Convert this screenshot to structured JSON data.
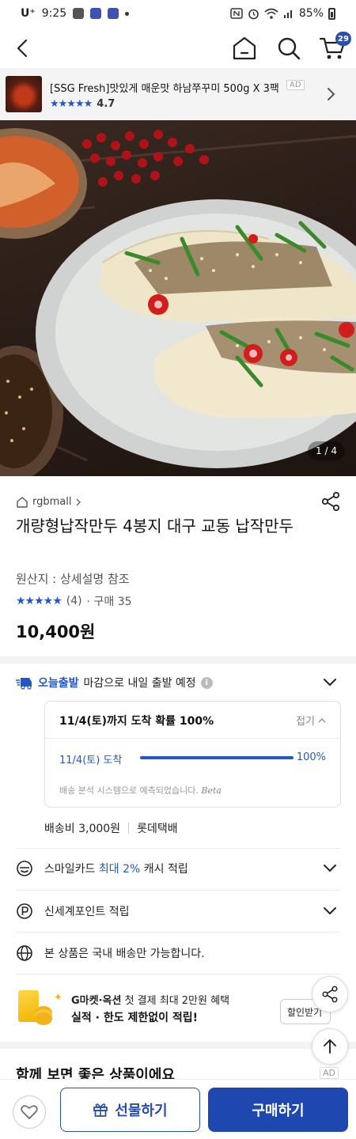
{
  "status_bar": {
    "carrier": "U⁺",
    "time": "9:25",
    "battery": "85%"
  },
  "cart": {
    "count": "29"
  },
  "ad_banner": {
    "title": "[SSG Fresh]맛있게 매운맛  하남쭈꾸미 500g X 3팩",
    "ad_label": "AD",
    "rating": "4.7",
    "stars": "★★★★★"
  },
  "gallery": {
    "counter": "1 / 4"
  },
  "product": {
    "seller": "rgbmall",
    "title": "개량형납작만두 4봉지 대구 교동 납작만두",
    "origin": "원산지 : 상세설명 참조",
    "stars": "★★★★★",
    "review_count": "(4)",
    "purchase_count": "· 구매 35",
    "price": "10,400원"
  },
  "shipping": {
    "brand": "오늘출발",
    "message": "마감으로 내일 출발 예정",
    "prob_title": "11/4(토)까지 도착 확률 100%",
    "fold_label": "접기",
    "arrive_date": "11/4(토) 도착",
    "arrive_pct_label": "100%",
    "arrive_pct": 100,
    "note": "배송 분석 시스템으로 예측되었습니다.",
    "note_beta": "Beta",
    "fee": "배송비 3,000원",
    "courier": "롯데택배"
  },
  "benefits": {
    "smile_prefix": "스마일카드",
    "smile_accent": "최대 2%",
    "smile_suffix": "캐시 적립",
    "shinsegae": "신세계포인트 적립",
    "domestic": "본 상품은 국내 배송만 가능합니다."
  },
  "promo": {
    "line1_bold": "G마켓·옥션",
    "line1_rest": " 첫 결제 최대 2만원 혜택",
    "line2": "실적 · 한도 제한없이 적립!",
    "button": "할인받기"
  },
  "recommend": {
    "title": "함께 보면 좋은 상품이에요",
    "ad_label": "AD"
  },
  "bottom_bar": {
    "gift": "선물하기",
    "buy": "구매하기"
  },
  "colors": {
    "accent": "#2457c5",
    "primary_button": "#1f47b0"
  }
}
